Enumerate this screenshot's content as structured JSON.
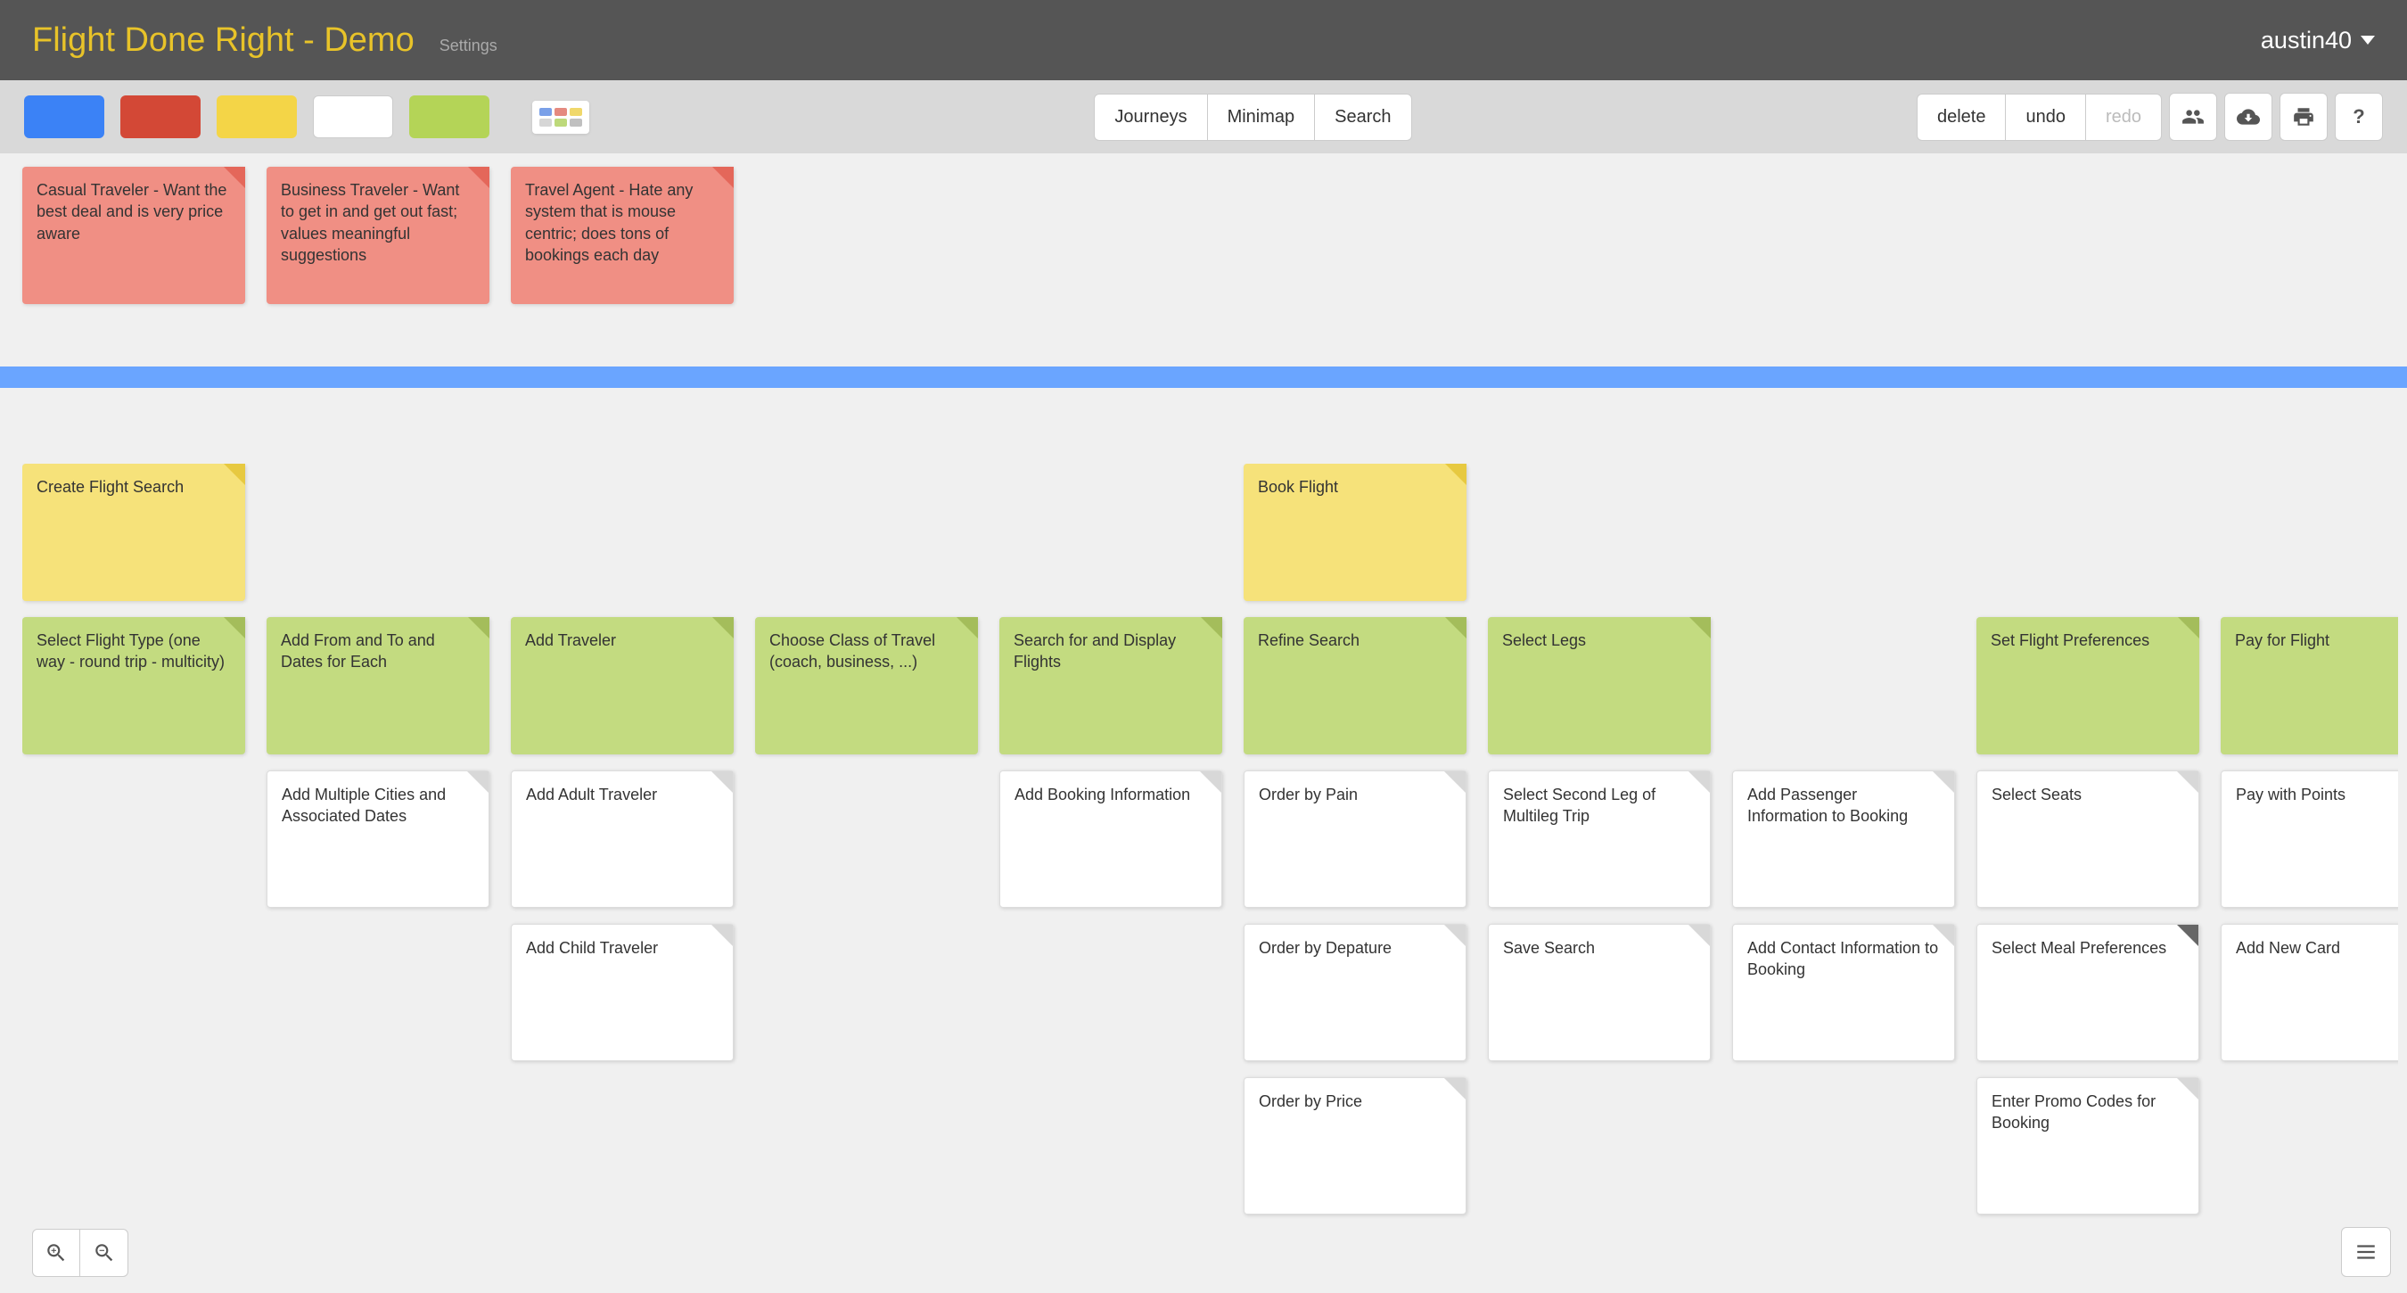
{
  "app": {
    "title": "Flight Done Right - Demo",
    "settings_label": "Settings",
    "user": "austin40"
  },
  "toolbar": {
    "color_swatches": [
      "blue",
      "red",
      "yellow",
      "white",
      "green"
    ],
    "center_tabs": {
      "journeys": "Journeys",
      "minimap": "Minimap",
      "search": "Search"
    },
    "right": {
      "delete": "delete",
      "undo": "undo",
      "redo": "redo",
      "redo_disabled": true
    },
    "icons": {
      "share": "share-icon",
      "cloud": "cloud-download-icon",
      "print": "printer-icon",
      "help": "?"
    }
  },
  "personas": [
    {
      "text": "Casual Traveler - Want the best deal and is very price aware"
    },
    {
      "text": "Business Traveler - Want to get in and get out fast; values meaningful suggestions"
    },
    {
      "text": "Travel Agent -  Hate any system that is mouse centric; does tons of bookings each day"
    }
  ],
  "columns": [
    {
      "epic": "Create Flight Search",
      "activity": "Select Flight Type (one way - round trip - multicity)",
      "stories": []
    },
    {
      "epic": null,
      "activity": "Add From and To and Dates for Each",
      "stories": [
        "Add Multiple Cities and Associated Dates"
      ]
    },
    {
      "epic": null,
      "activity": "Add Traveler",
      "stories": [
        "Add Adult Traveler",
        "Add Child Traveler"
      ]
    },
    {
      "epic": null,
      "activity": "Choose Class of Travel (coach, business, ...)",
      "stories": []
    },
    {
      "epic": null,
      "activity": "Search for and Display Flights",
      "stories": [
        "Add Booking Information"
      ]
    },
    {
      "epic": "Book Flight",
      "activity": "Refine Search",
      "stories": [
        "Order by Pain",
        "Order by Depature",
        "Order by Price"
      ]
    },
    {
      "epic": null,
      "activity": "Select Legs",
      "stories": [
        "Select Second Leg of Multileg Trip",
        "Save Search"
      ]
    },
    {
      "epic": null,
      "activity": null,
      "stories": [
        "Add Passenger Information to Booking",
        "Add Contact Information to Booking"
      ]
    },
    {
      "epic": null,
      "activity": "Set Flight Preferences",
      "stories": [
        "Select Seats",
        "Select Meal Preferences",
        "Enter Promo Codes for Booking"
      ],
      "alt": [
        false,
        true,
        false
      ]
    },
    {
      "epic": null,
      "activity": "Pay for Flight",
      "stories": [
        "Pay with Points",
        "Add New Card"
      ]
    }
  ],
  "canvas_meta": {
    "divider_color": "#6aa5ff"
  }
}
